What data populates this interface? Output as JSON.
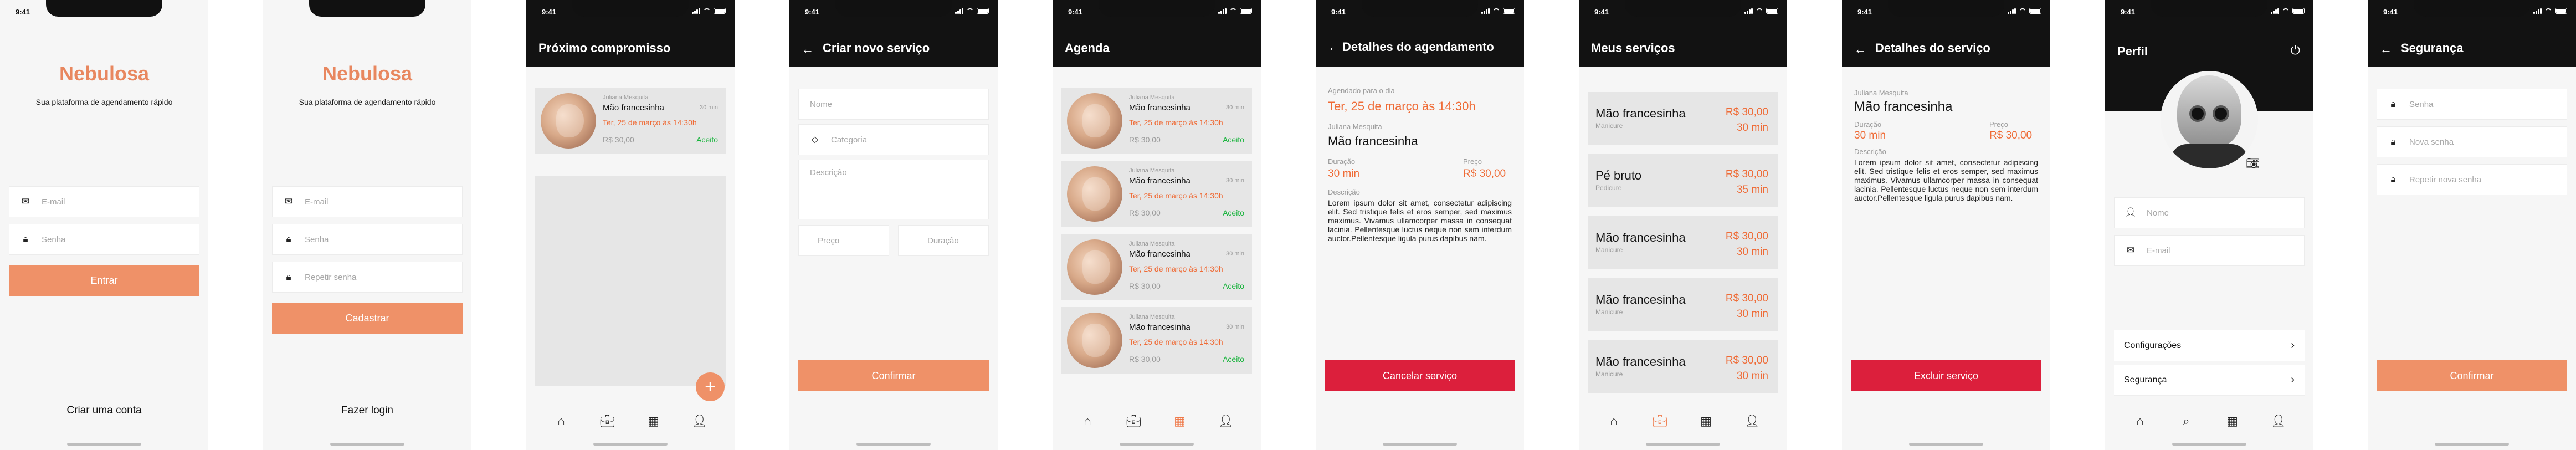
{
  "status": {
    "time": "9:41"
  },
  "login": {
    "brand": "Nebulosa",
    "tagline": "Sua plataforma de agendamento rápido",
    "email_placeholder": "E-mail",
    "password_placeholder": "Senha",
    "submit_label": "Entrar",
    "bottom_link": "Criar uma conta"
  },
  "signup": {
    "brand": "Nebulosa",
    "tagline": "Sua plataforma de agendamento rápido",
    "email_placeholder": "E-mail",
    "password_placeholder": "Senha",
    "repeat_placeholder": "Repetir senha",
    "submit_label": "Cadastrar",
    "bottom_link": "Fazer login"
  },
  "next": {
    "title": "Próximo compromisso",
    "card": {
      "client": "Juliana Mesquita",
      "service": "Mão francesinha",
      "duration": "30 min",
      "when": "Ter, 25 de março às 14:30h",
      "price": "R$ 30,00",
      "status": "Aceito"
    }
  },
  "create": {
    "title": "Criar novo serviço",
    "name_placeholder": "Nome",
    "category_placeholder": "Categoria",
    "description_placeholder": "Descrição",
    "price_placeholder": "Preço",
    "duration_placeholder": "Duração",
    "submit_label": "Confirmar"
  },
  "agenda": {
    "title": "Agenda",
    "cards": [
      {
        "client": "Juliana Mesquita",
        "service": "Mão francesinha",
        "duration": "30 min",
        "when": "Ter, 25 de março às 14:30h",
        "price": "R$ 30,00",
        "status": "Aceito"
      },
      {
        "client": "Juliana Mesquita",
        "service": "Mão francesinha",
        "duration": "30 min",
        "when": "Ter, 25 de março às 14:30h",
        "price": "R$ 30,00",
        "status": "Aceito"
      },
      {
        "client": "Juliana Mesquita",
        "service": "Mão francesinha",
        "duration": "30 min",
        "when": "Ter, 25 de março às 14:30h",
        "price": "R$ 30,00",
        "status": "Aceito"
      },
      {
        "client": "Juliana Mesquita",
        "service": "Mão francesinha",
        "duration": "30 min",
        "when": "Ter, 25 de março às 14:30h",
        "price": "R$ 30,00",
        "status": "Aceito"
      }
    ]
  },
  "appointment": {
    "title": "Detalhes do agendamento",
    "scheduled_label": "Agendado para o dia",
    "when": "Ter, 25 de março às 14:30h",
    "client": "Juliana Mesquita",
    "service": "Mão francesinha",
    "duration_label": "Duração",
    "duration": "30 min",
    "price_label": "Preço",
    "price": "R$ 30,00",
    "description_label": "Descrição",
    "description": "Lorem ipsum dolor sit amet, consectetur adipiscing elit. Sed tristique felis et eros semper, sed maximus maximus. Vivamus ullamcorper massa in consequat lacinia. Pellentesque luctus neque non sem interdum auctor.Pellentesque ligula purus dapibus nam.",
    "cancel_label": "Cancelar serviço"
  },
  "services": {
    "title": "Meus serviços",
    "items": [
      {
        "name": "Mão francesinha",
        "category": "Manicure",
        "price": "R$ 30,00",
        "duration": "30 min"
      },
      {
        "name": "Pé bruto",
        "category": "Pedicure",
        "price": "R$ 30,00",
        "duration": "35 min"
      },
      {
        "name": "Mão francesinha",
        "category": "Manicure",
        "price": "R$ 30,00",
        "duration": "30 min"
      },
      {
        "name": "Mão francesinha",
        "category": "Manicure",
        "price": "R$ 30,00",
        "duration": "30 min"
      },
      {
        "name": "Mão francesinha",
        "category": "Manicure",
        "price": "R$ 30,00",
        "duration": "30 min"
      }
    ]
  },
  "service_detail": {
    "title": "Detalhes do serviço",
    "client": "Juliana Mesquita",
    "service": "Mão francesinha",
    "duration_label": "Duração",
    "duration": "30 min",
    "price_label": "Preço",
    "price": "R$ 30,00",
    "description_label": "Descrição",
    "description": "Lorem ipsum dolor sit amet, consectetur adipiscing elit. Sed tristique felis et eros semper, sed maximus maximus. Vivamus ullamcorper massa in consequat lacinia. Pellentesque luctus neque non sem interdum auctor.Pellentesque ligula purus dapibus nam.",
    "delete_label": "Excluir serviço"
  },
  "profile": {
    "title": "Perfil",
    "name_placeholder": "Nome",
    "email_placeholder": "E-mail",
    "settings_label": "Configurações",
    "security_label": "Segurança"
  },
  "security": {
    "title": "Segurança",
    "password_placeholder": "Senha",
    "new_password_placeholder": "Nova senha",
    "repeat_placeholder": "Repetir nova senha",
    "submit_label": "Confirmar"
  },
  "colors": {
    "accent": "#ef9168",
    "accent_text": "#ef6b36",
    "danger": "#dc1f3c",
    "success": "#18b43c",
    "appbar": "#121212"
  },
  "icons": {
    "home": "home-icon",
    "services": "briefcase-icon",
    "calendar": "calendar-icon",
    "profile": "user-icon",
    "search": "search-icon"
  }
}
